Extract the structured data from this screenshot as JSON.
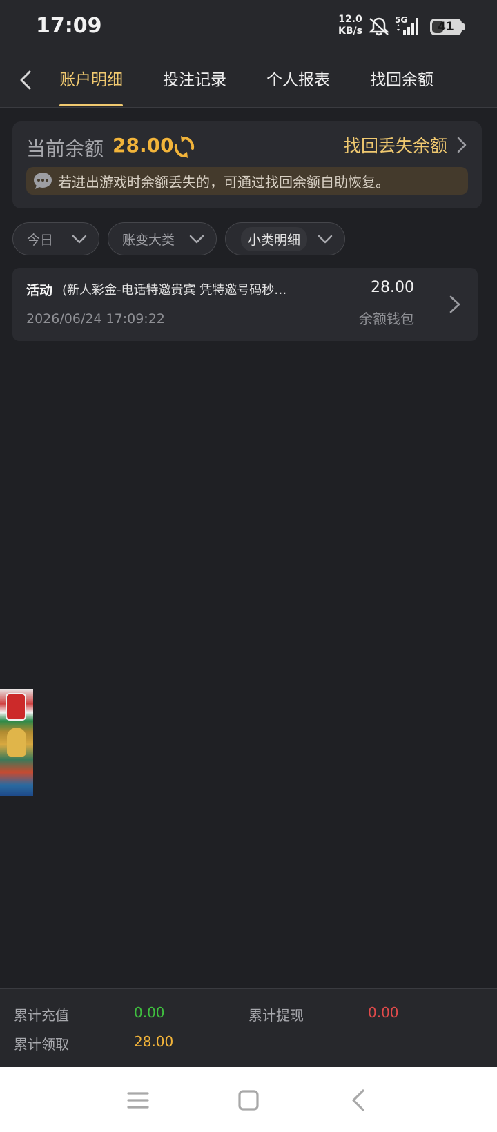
{
  "status": {
    "time": "17:09",
    "net_speed_value": "12.0",
    "net_speed_unit": "KB/s",
    "network_type": "5G",
    "battery_level": "41",
    "battery_fraction": 0.41,
    "icons": [
      "mute-icon",
      "signal-icon",
      "battery-icon"
    ]
  },
  "nav": {
    "back_icon": "chevron-left-icon",
    "tabs": [
      {
        "label": "账户明细",
        "active": true
      },
      {
        "label": "投注记录",
        "active": false
      },
      {
        "label": "个人报表",
        "active": false
      },
      {
        "label": "找回余额",
        "active": false
      }
    ]
  },
  "balance": {
    "label": "当前余额",
    "value": "28.00",
    "refresh_icon": "refresh-icon",
    "recover_label": "找回丢失余额",
    "notice": "若进出游戏时余额丢失的，可通过找回余额自助恢复。"
  },
  "filters": [
    {
      "label": "今日"
    },
    {
      "label": "账变大类"
    },
    {
      "label": "小类明细"
    }
  ],
  "records": [
    {
      "type": "活动",
      "description": "(新人彩金-电话特邀贵宾 凭特邀号码秒…",
      "time": "2026/06/24 17:09:22",
      "amount": "28.00",
      "wallet": "余额钱包"
    }
  ],
  "summary": {
    "recharge_label": "累计充值",
    "recharge_value": "0.00",
    "withdraw_label": "累计提现",
    "withdraw_value": "0.00",
    "claim_label": "累计领取",
    "claim_value": "28.00"
  },
  "colors": {
    "accent_gold": "#f0c970",
    "balance_orange": "#f2b43a",
    "green": "#3fbf3f",
    "red": "#e04a4a",
    "background": "#1f2024"
  }
}
